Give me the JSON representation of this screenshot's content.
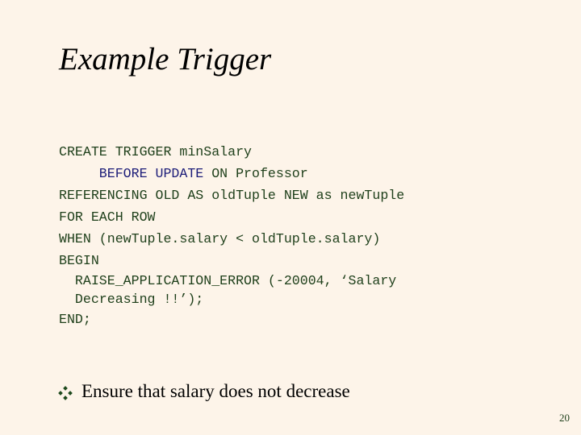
{
  "slide": {
    "title": "Example Trigger",
    "code": {
      "line1": "CREATE TRIGGER minSalary",
      "line2_indent": "     ",
      "line2_keyword": "BEFORE UPDATE",
      "line2_rest": " ON Professor",
      "line3": "REFERENCING OLD AS oldTuple NEW as newTuple",
      "line4": "FOR EACH ROW",
      "line5": "WHEN (newTuple.salary < oldTuple.salary)",
      "line6": "BEGIN",
      "line7": "  RAISE_APPLICATION_ERROR (-20004, ‘Salary",
      "line8": "  Decreasing !!’);",
      "line9": "END;"
    },
    "bullets": [
      {
        "icon": "diamond-bullet-icon",
        "text": "Ensure that salary does not decrease"
      }
    ],
    "page_number": "20"
  },
  "colors": {
    "background": "#fdf4e9",
    "code_text": "#1e3f1a",
    "keyword_highlight": "#1c1c78"
  }
}
